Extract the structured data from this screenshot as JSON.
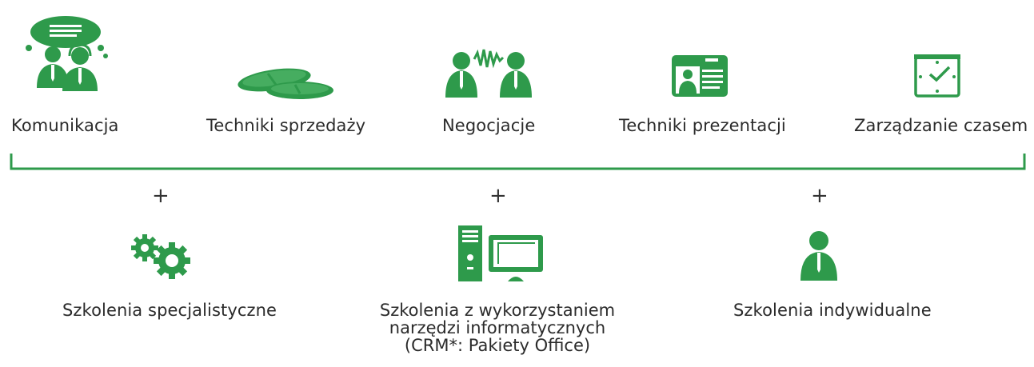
{
  "colors": {
    "accent": "#2e9a4b",
    "text": "#2b2b2b"
  },
  "top_row": [
    {
      "label": "Komunikacja",
      "icon": "conversation-icon"
    },
    {
      "label": "Techniki sprzedaży",
      "icon": "coins-icon"
    },
    {
      "label": "Negocjacje",
      "icon": "negotiation-icon"
    },
    {
      "label": "Techniki prezentacji",
      "icon": "id-card-icon"
    },
    {
      "label": "Zarządzanie czasem",
      "icon": "clock-icon"
    }
  ],
  "connector": {
    "plus": "+"
  },
  "bottom_row": [
    {
      "label": "Szkolenia specjalistyczne",
      "icon": "gears-icon"
    },
    {
      "label_lines": [
        "Szkolenia z wykorzystaniem",
        "narzędzi informatycznych",
        "(CRM*: Pakiety Office)"
      ],
      "icon": "computer-icon"
    },
    {
      "label": "Szkolenia indywidualne",
      "icon": "person-icon"
    }
  ]
}
